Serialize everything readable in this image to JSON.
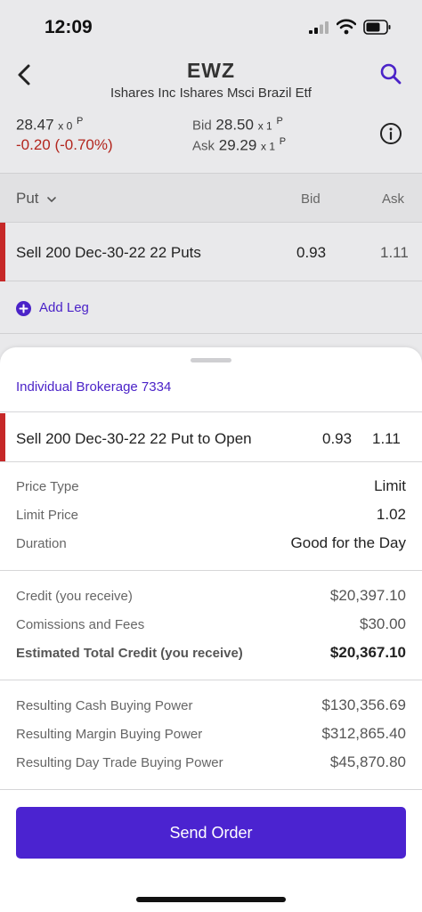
{
  "status_bar": {
    "time": "12:09"
  },
  "header": {
    "symbol": "EWZ",
    "name": "Ishares Inc Ishares Msci Brazil Etf"
  },
  "quote": {
    "last": "28.47",
    "last_size": "x 0",
    "last_exchange": "P",
    "change": "-0.20 (-0.70%)",
    "bid_label": "Bid",
    "bid": "28.50",
    "bid_size": "x 1",
    "bid_exchange": "P",
    "ask_label": "Ask",
    "ask": "29.29",
    "ask_size": "x 1",
    "ask_exchange": "P"
  },
  "chain": {
    "option_type": "Put",
    "bid_header": "Bid",
    "ask_header": "Ask",
    "leg": {
      "description": "Sell 200 Dec-30-22 22 Puts",
      "bid": "0.93",
      "ask": "1.11"
    },
    "add_leg_label": "Add Leg"
  },
  "order": {
    "account": "Individual Brokerage 7334",
    "leg": {
      "description": "Sell 200 Dec-30-22 22 Put to Open",
      "bid": "0.93",
      "ask": "1.11"
    },
    "details": [
      {
        "label": "Price Type",
        "value": "Limit"
      },
      {
        "label": "Limit Price",
        "value": "1.02"
      },
      {
        "label": "Duration",
        "value": "Good for the Day"
      }
    ],
    "totals": [
      {
        "label": "Credit (you receive)",
        "value": "$20,397.10"
      },
      {
        "label": "Comissions and Fees",
        "value": "$30.00"
      },
      {
        "label": "Estimated Total Credit (you receive)",
        "value": "$20,367.10"
      }
    ],
    "buying_power": [
      {
        "label": "Resulting Cash Buying Power",
        "value": "$130,356.69"
      },
      {
        "label": "Resulting Margin Buying Power",
        "value": "$312,865.40"
      },
      {
        "label": "Resulting Day Trade Buying Power",
        "value": "$45,870.80"
      }
    ],
    "send_label": "Send Order"
  },
  "colors": {
    "accent": "#4b23d0",
    "negative": "#c62828"
  },
  "icons": [
    "back-chevron-icon",
    "search-icon",
    "info-icon",
    "chevron-down-icon",
    "plus-circle-icon",
    "signal-icon",
    "wifi-icon",
    "battery-icon"
  ]
}
